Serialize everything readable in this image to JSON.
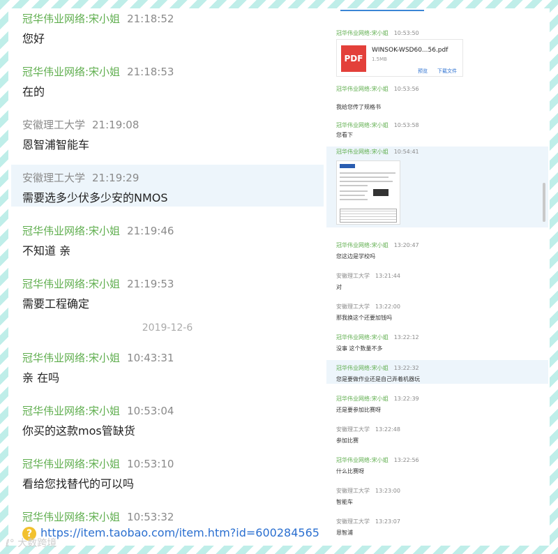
{
  "left_chat": {
    "messages": [
      {
        "name": "冠华伟业网络:宋小姐",
        "time": "21:18:52",
        "text": "您好",
        "sender": "seller"
      },
      {
        "name": "冠华伟业网络:宋小姐",
        "time": "21:18:53",
        "text": "在的",
        "sender": "seller"
      },
      {
        "name": "安徽理工大学",
        "time": "21:19:08",
        "text": "恩智浦智能车",
        "sender": "buyer"
      },
      {
        "name": "安徽理工大学",
        "time": "21:19:29",
        "text": "需要选多少伏多少安的NMOS",
        "sender": "buyer"
      },
      {
        "name": "冠华伟业网络:宋小姐",
        "time": "21:19:46",
        "text": "不知道 亲",
        "sender": "seller"
      },
      {
        "name": "冠华伟业网络:宋小姐",
        "time": "21:19:53",
        "text": "需要工程确定",
        "sender": "seller"
      },
      {
        "name": "冠华伟业网络:宋小姐",
        "time": "10:43:31",
        "text": "亲 在吗",
        "sender": "seller"
      },
      {
        "name": "冠华伟业网络:宋小姐",
        "time": "10:53:04",
        "text": "你买的这款mos管缺货",
        "sender": "seller"
      },
      {
        "name": "冠华伟业网络:宋小姐",
        "time": "10:53:10",
        "text": "看给您找替代的可以吗",
        "sender": "seller"
      },
      {
        "name": "冠华伟业网络:宋小姐",
        "time": "10:53:32",
        "text": "",
        "sender": "seller"
      }
    ],
    "date_separator": "2019-12-6",
    "link_text": "https://item.taobao.com/item.htm?id=600284565",
    "watermark": "大数跨境"
  },
  "right_top": {
    "msg1": {
      "name": "冠华伟业网络:宋小姐",
      "time": "10:53:50"
    },
    "file": {
      "type_label": "PDF",
      "name": "WINSOK-WSD60...56.pdf",
      "size": "1.5MB",
      "action_preview": "预览",
      "action_download": "下载文件"
    },
    "msg2": {
      "name": "冠华伟业网络:宋小姐",
      "time": "10:53:56",
      "text": "我给您传了规格书"
    },
    "msg3": {
      "name": "冠华伟业网络:宋小姐",
      "time": "10:53:58",
      "text": "您看下"
    },
    "msg4": {
      "name": "冠华伟业网络:宋小姐",
      "time": "10:54:41"
    }
  },
  "right_bottom": {
    "messages": [
      {
        "name": "冠华伟业网络:宋小姐",
        "time": "13:20:47",
        "text": "您这边是学校吗",
        "sender": "seller"
      },
      {
        "name": "安徽理工大学",
        "time": "13:21:44",
        "text": "对",
        "sender": "buyer"
      },
      {
        "name": "安徽理工大学",
        "time": "13:22:00",
        "text": "那我换这个还要加钱吗",
        "sender": "buyer"
      },
      {
        "name": "冠华伟业网络:宋小姐",
        "time": "13:22:12",
        "text": "没事 这个数量不多",
        "sender": "seller"
      },
      {
        "name": "冠华伟业网络:宋小姐",
        "time": "13:22:32",
        "text": "您是要做作业还是自己弄着机器玩",
        "sender": "seller"
      },
      {
        "name": "冠华伟业网络:宋小姐",
        "time": "13:22:39",
        "text": "还是要参加比赛呀",
        "sender": "seller"
      },
      {
        "name": "安徽理工大学",
        "time": "13:22:48",
        "text": "参加比赛",
        "sender": "buyer"
      },
      {
        "name": "冠华伟业网络:宋小姐",
        "time": "13:22:56",
        "text": "什么比赛呀",
        "sender": "seller"
      },
      {
        "name": "安徽理工大学",
        "time": "13:23:00",
        "text": "智能车",
        "sender": "buyer"
      },
      {
        "name": "安徽理工大学",
        "time": "13:23:07",
        "text": "恩智浦",
        "sender": "buyer"
      }
    ]
  },
  "colors": {
    "seller_name": "#5fae4e",
    "buyer_name": "#8a8a8a",
    "highlight": "#edf5fb",
    "link": "#2a6fd0",
    "pdf_red": "#e3403a",
    "frame_cyan": "#bfeee9"
  },
  "icons": {
    "pdf": "pdf-file-icon",
    "question": "help-question-icon",
    "watermark_logo": "watermark-logo-icon"
  }
}
